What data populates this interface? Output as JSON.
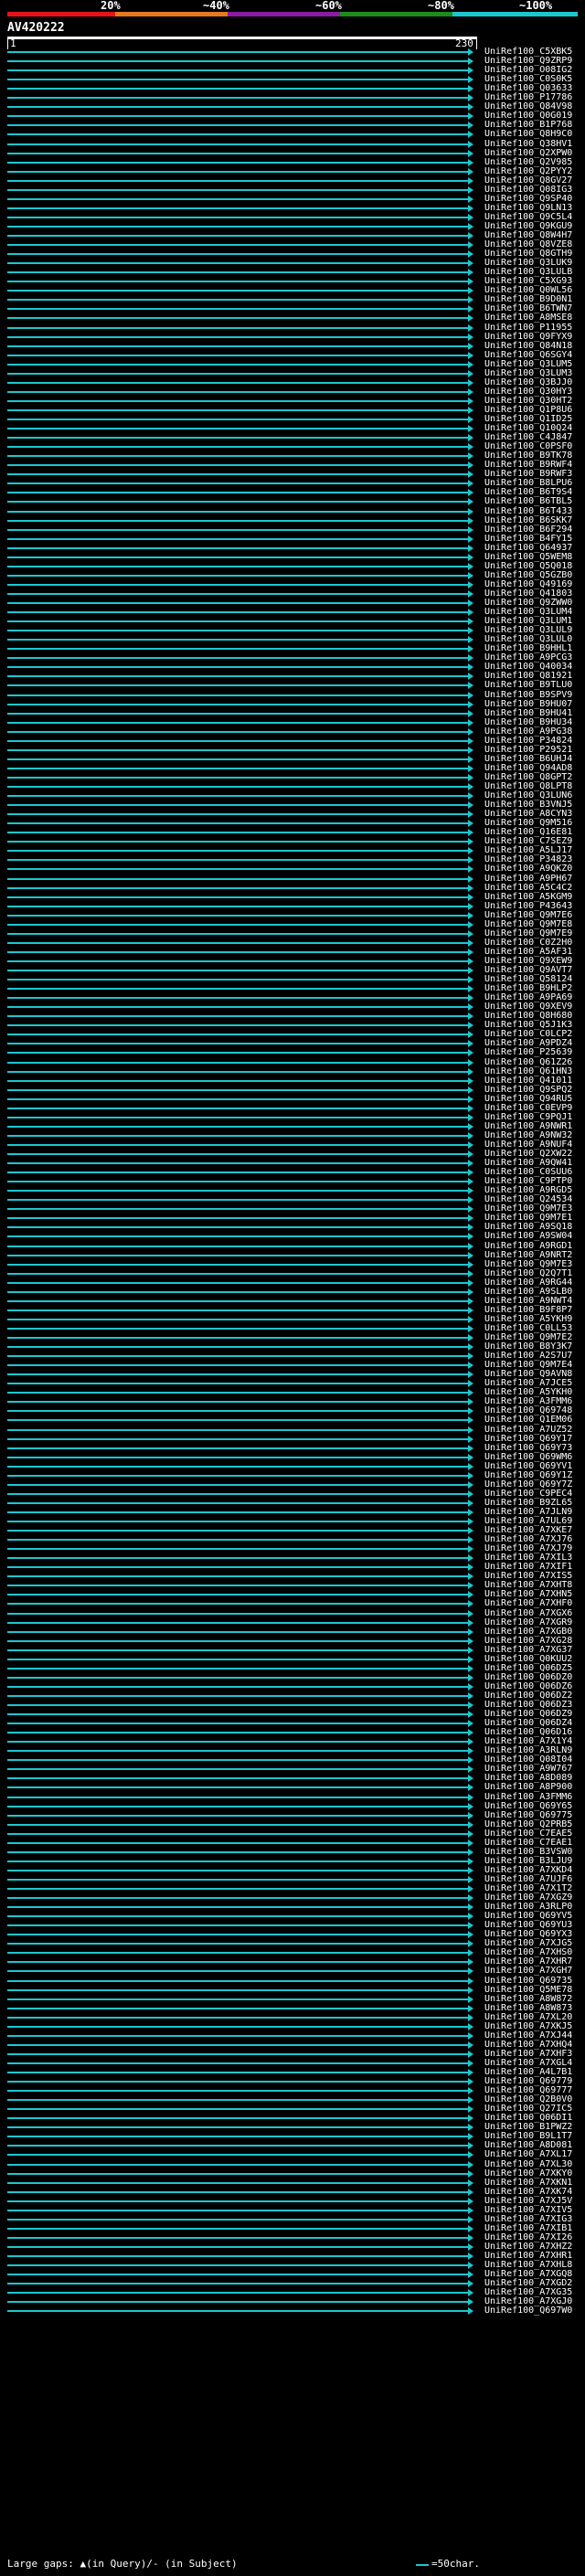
{
  "scale": {
    "labels": [
      "20%",
      "~40%",
      "~60%",
      "~80%",
      "~100%"
    ],
    "colors": [
      "#e8111a",
      "#e8781c",
      "#8b1ba3",
      "#1c8d1c",
      "#1bc7cf"
    ]
  },
  "query": {
    "title": "AV420222",
    "start": "1",
    "end": "230"
  },
  "hits": [
    "UniRef100_C5XBK5",
    "UniRef100_Q9ZRP9",
    "UniRef100_O08IG2",
    "UniRef100_C0S0K5",
    "UniRef100_Q03633",
    "UniRef100_P17786",
    "UniRef100_Q84V98",
    "UniRef100_Q0G019",
    "UniRef100_B1P768",
    "UniRef100_Q8H9C0",
    "UniRef100_Q38HV1",
    "UniRef100_Q2XPW0",
    "UniRef100_Q2V985",
    "UniRef100_Q2PYY2",
    "UniRef100_Q8GV27",
    "UniRef100_Q08IG3",
    "UniRef100_Q9SP40",
    "UniRef100_Q9LN13",
    "UniRef100_Q9C5L4",
    "UniRef100_Q9KGU9",
    "UniRef100_Q8W4H7",
    "UniRef100_Q8VZE8",
    "UniRef100_Q8GTH9",
    "UniRef100_Q3LUK9",
    "UniRef100_Q3LULB",
    "UniRef100_C5XG93",
    "UniRef100_Q0WL56",
    "UniRef100_B9D0N1",
    "UniRef100_B6TWN7",
    "UniRef100_A8MSE8",
    "UniRef100_P11955",
    "UniRef100_Q9FYX9",
    "UniRef100_Q84N18",
    "UniRef100_Q6SGY4",
    "UniRef100_Q3LUM5",
    "UniRef100_Q3LUM3",
    "UniRef100_Q3BJJ0",
    "UniRef100_Q30HY3",
    "UniRef100_Q30HT2",
    "UniRef100_Q1P8U6",
    "UniRef100_Q1ID25",
    "UniRef100_Q10Q24",
    "UniRef100_C4J847",
    "UniRef100_C0PSF0",
    "UniRef100_B9TK78",
    "UniRef100_B9RWF4",
    "UniRef100_B9RWF3",
    "UniRef100_B8LPU6",
    "UniRef100_B6T9S4",
    "UniRef100_B6TBL5",
    "UniRef100_B6T433",
    "UniRef100_B6SKK7",
    "UniRef100_B6F294",
    "UniRef100_B4FY15",
    "UniRef100_Q64937",
    "UniRef100_Q5WEM8",
    "UniRef100_Q5Q018",
    "UniRef100_Q5GZB0",
    "UniRef100_Q49169",
    "UniRef100_Q41803",
    "UniRef100_Q9ZWW0",
    "UniRef100_Q3LUM4",
    "UniRef100_Q3LUM1",
    "UniRef100_Q3LUL9",
    "UniRef100_Q3LUL0",
    "UniRef100_B9HHL1",
    "UniRef100_A9PCG3",
    "UniRef100_Q40034",
    "UniRef100_Q81921",
    "UniRef100_B9TLU0",
    "UniRef100_B9SPV9",
    "UniRef100_B9HU07",
    "UniRef100_B9HU41",
    "UniRef100_B9HU34",
    "UniRef100_A9PG38",
    "UniRef100_P34824",
    "UniRef100_P29521",
    "UniRef100_B6UHJ4",
    "UniRef100_Q94AD8",
    "UniRef100_Q8GPT2",
    "UniRef100_Q8LPT8",
    "UniRef100_Q3LUN6",
    "UniRef100_B3VNJ5",
    "UniRef100_A8CYN3",
    "UniRef100_Q9M516",
    "UniRef100_Q16E81",
    "UniRef100_C7SEZ9",
    "UniRef100_A5LJ17",
    "UniRef100_P34823",
    "UniRef100_A9QKZ0",
    "UniRef100_A9PH67",
    "UniRef100_A5C4C2",
    "UniRef100_A5KGM9",
    "UniRef100_P43643",
    "UniRef100_Q9M7E6",
    "UniRef100_Q9M7E8",
    "UniRef100_Q9M7E9",
    "UniRef100_C0Z2H0",
    "UniRef100_A5AF31",
    "UniRef100_Q9XEW9",
    "UniRef100_Q9AVT7",
    "UniRef100_Q58124",
    "UniRef100_B9HLP2",
    "UniRef100_A9PA69",
    "UniRef100_Q9XEV9",
    "UniRef100_Q8H680",
    "UniRef100_Q5J1K3",
    "UniRef100_C0LCP2",
    "UniRef100_A9PDZ4",
    "UniRef100_P25639",
    "UniRef100_Q61Z26",
    "UniRef100_Q61HN3",
    "UniRef100_Q41011",
    "UniRef100_Q9SPQ2",
    "UniRef100_Q94RU5",
    "UniRef100_C0EVP9",
    "UniRef100_C9PQJ1",
    "UniRef100_A9NWR1",
    "UniRef100_A9NW32",
    "UniRef100_A9NUF4",
    "UniRef100_Q2XW22",
    "UniRef100_A9QW41",
    "UniRef100_C0SUU6",
    "UniRef100_C9PTP0",
    "UniRef100_A9RGD5",
    "UniRef100_Q24534",
    "UniRef100_Q9M7E3",
    "UniRef100_Q9M7E1",
    "UniRef100_A9SQ18",
    "UniRef100_A9SW04",
    "UniRef100_A9RGD1",
    "UniRef100_A9NRT2",
    "UniRef100_Q9M7E3",
    "UniRef100_Q2Q7T1",
    "UniRef100_A9RG44",
    "UniRef100_A9SLB0",
    "UniRef100_A9NWT4",
    "UniRef100_B9F8P7",
    "UniRef100_A5YKH9",
    "UniRef100_C0LL53",
    "UniRef100_Q9M7E2",
    "UniRef100_B8Y3K7",
    "UniRef100_A2S7U7",
    "UniRef100_Q9M7E4",
    "UniRef100_Q9AVN8",
    "UniRef100_A7JCE5",
    "UniRef100_A5YKH0",
    "UniRef100_A3FMM6",
    "UniRef100_Q69748",
    "UniRef100_Q1EM06",
    "UniRef100_A7UZ52",
    "UniRef100_Q69Y17",
    "UniRef100_Q69Y73",
    "UniRef100_Q69WM6",
    "UniRef100_Q69YV1",
    "UniRef100_Q69Y1Z",
    "UniRef100_Q69Y7Z",
    "UniRef100_C9PEC4",
    "UniRef100_B9ZL65",
    "UniRef100_A7JLN9",
    "UniRef100_A7UL69",
    "UniRef100_A7XKE7",
    "UniRef100_A7XJ76",
    "UniRef100_A7XJ79",
    "UniRef100_A7XIL3",
    "UniRef100_A7XIF1",
    "UniRef100_A7XIS5",
    "UniRef100_A7XHT8",
    "UniRef100_A7XHN5",
    "UniRef100_A7XHF0",
    "UniRef100_A7XGX6",
    "UniRef100_A7XGR9",
    "UniRef100_A7XGB0",
    "UniRef100_A7XG28",
    "UniRef100_A7XG37",
    "UniRef100_Q0KUU2",
    "UniRef100_Q06DZ5",
    "UniRef100_Q06DZ0",
    "UniRef100_Q06DZ6",
    "UniRef100_Q06DZ2",
    "UniRef100_Q06DZ3",
    "UniRef100_Q06DZ9",
    "UniRef100_Q06DZ4",
    "UniRef100_Q06D16",
    "UniRef100_A7X1Y4",
    "UniRef100_A3RLN9",
    "UniRef100_Q08I04",
    "UniRef100_A9W767",
    "UniRef100_A8D089",
    "UniRef100_A8P900",
    "UniRef100_A3FMM6",
    "UniRef100_Q69Y65",
    "UniRef100_Q69775",
    "UniRef100_Q2PRB5",
    "UniRef100_C7EAE5",
    "UniRef100_C7EAE1",
    "UniRef100_B3VSW0",
    "UniRef100_B3LJU9",
    "UniRef100_A7XKD4",
    "UniRef100_A7UJF6",
    "UniRef100_A7X1T2",
    "UniRef100_A7XGZ9",
    "UniRef100_A3RLP0",
    "UniRef100_Q69YV5",
    "UniRef100_Q69YU3",
    "UniRef100_Q69YX3",
    "UniRef100_A7XJG5",
    "UniRef100_A7XHS0",
    "UniRef100_A7XHR7",
    "UniRef100_A7XGH7",
    "UniRef100_Q69735",
    "UniRef100_Q5ME78",
    "UniRef100_A8W872",
    "UniRef100_A8W873",
    "UniRef100_A7XL20",
    "UniRef100_A7XKJ5",
    "UniRef100_A7XJ44",
    "UniRef100_A7XHQ4",
    "UniRef100_A7XHF3",
    "UniRef100_A7XGL4",
    "UniRef100_A4L7B1",
    "UniRef100_Q69779",
    "UniRef100_Q69777",
    "UniRef100_Q2B0V0",
    "UniRef100_Q27IC5",
    "UniRef100_Q06DI1",
    "UniRef100_B1PWZ2",
    "UniRef100_B9L1T7",
    "UniRef100_A8D081",
    "UniRef100_A7XL17",
    "UniRef100_A7XL30",
    "UniRef100_A7XKY0",
    "UniRef100_A7XKN1",
    "UniRef100_A7XK74",
    "UniRef100_A7XJ5V",
    "UniRef100_A7XIV5",
    "UniRef100_A7XIG3",
    "UniRef100_A7XIB1",
    "UniRef100_A7XI26",
    "UniRef100_A7XHZ2",
    "UniRef100_A7XHR1",
    "UniRef100_A7XHL8",
    "UniRef100_A7XGQ8",
    "UniRef100_A7XGD2",
    "UniRef100_A7XG35",
    "UniRef100_A7XGJ0",
    "UniRef100_Q697W0"
  ],
  "footer": {
    "gaps_text": "Large gaps: ▲(in Query)/- (in Subject)",
    "legend_text": "=50char."
  }
}
